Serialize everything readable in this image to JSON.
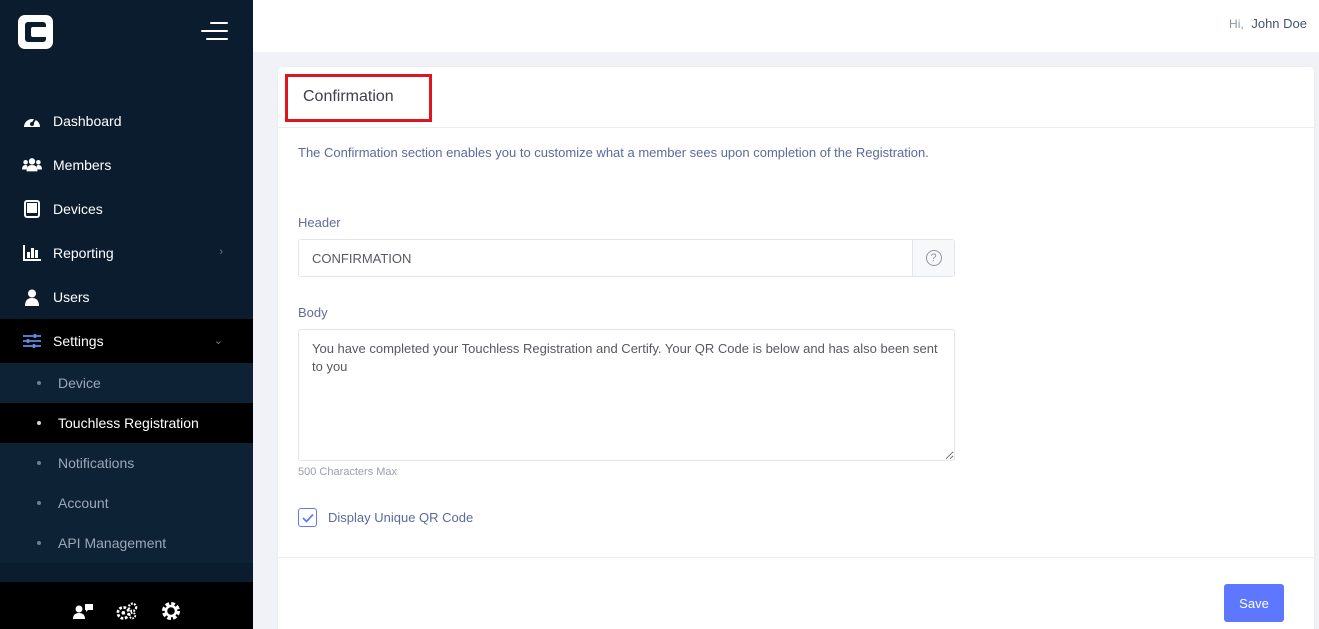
{
  "app": {
    "logo_icon": "brand-c-logo-icon",
    "menu_icon": "hamburger-icon"
  },
  "sidebar": {
    "items": [
      {
        "label": "Dashboard",
        "icon": "speedometer-icon"
      },
      {
        "label": "Members",
        "icon": "users-icon"
      },
      {
        "label": "Devices",
        "icon": "tablet-icon"
      },
      {
        "label": "Reporting",
        "icon": "bar-chart-icon",
        "chevron": "›"
      },
      {
        "label": "Users",
        "icon": "user-icon"
      },
      {
        "label": "Settings",
        "icon": "sliders-icon",
        "chevron": "⌄"
      }
    ],
    "sub_items": [
      {
        "label": "Device"
      },
      {
        "label": "Touchless Registration"
      },
      {
        "label": "Notifications"
      },
      {
        "label": "Account"
      },
      {
        "label": "API Management"
      }
    ],
    "footer_icons": [
      "user-chat-icon",
      "gears-icon",
      "gear-icon"
    ]
  },
  "topbar": {
    "greeting": "Hi,",
    "user_name": "John Doe"
  },
  "card": {
    "title": "Confirmation",
    "description": "The Confirmation section enables you to customize what a member sees upon completion of the Registration.",
    "header_label": "Header",
    "header_value": "CONFIRMATION",
    "help_glyph": "?",
    "body_label": "Body",
    "body_value": "You have completed your Touchless Registration and Certify. Your QR Code is below and has also been sent to you",
    "body_hint": "500 Characters Max",
    "checkbox_label": "Display Unique QR Code",
    "checkbox_checked": true,
    "save_label": "Save"
  },
  "colors": {
    "sidebar_bg": "#0b1c2f",
    "accent": "#5d78ff",
    "highlight_border": "#e0141e"
  }
}
